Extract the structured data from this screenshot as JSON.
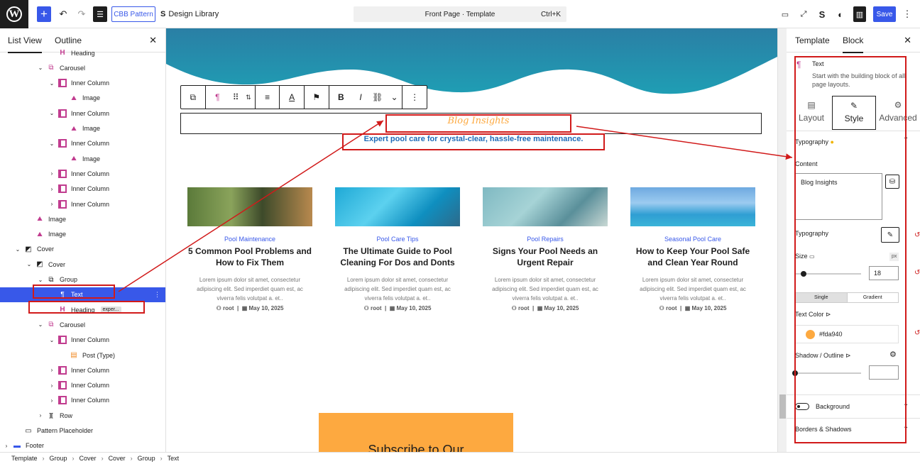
{
  "topbar": {
    "pattern_label": "CBB Pattern",
    "design_library": "Design Library",
    "command_title": "Front Page · Template",
    "command_shortcut": "Ctrl+K",
    "save": "Save"
  },
  "left_panel": {
    "tabs": [
      "List View",
      "Outline"
    ],
    "rows": [
      {
        "label": "Heading",
        "indent": 5,
        "icon": "heading-icon",
        "badge": ""
      },
      {
        "label": "Carousel",
        "indent": 4,
        "icon": "carousel-icon",
        "chev": "⌄"
      },
      {
        "label": "Inner Column",
        "indent": 5,
        "icon": "column-icon",
        "chev": "⌄"
      },
      {
        "label": "Image",
        "indent": 6,
        "icon": "image-icon"
      },
      {
        "label": "Inner Column",
        "indent": 5,
        "icon": "column-icon",
        "chev": "⌄"
      },
      {
        "label": "Image",
        "indent": 6,
        "icon": "image-icon"
      },
      {
        "label": "Inner Column",
        "indent": 5,
        "icon": "column-icon",
        "chev": "⌄"
      },
      {
        "label": "Image",
        "indent": 6,
        "icon": "image-icon"
      },
      {
        "label": "Inner Column",
        "indent": 5,
        "icon": "column-icon",
        "chev": "›"
      },
      {
        "label": "Inner Column",
        "indent": 5,
        "icon": "column-icon",
        "chev": "›"
      },
      {
        "label": "Inner Column",
        "indent": 5,
        "icon": "column-icon",
        "chev": "›"
      },
      {
        "label": "Image",
        "indent": 3,
        "icon": "image-icon"
      },
      {
        "label": "Image",
        "indent": 3,
        "icon": "image-icon"
      },
      {
        "label": "Cover",
        "indent": 2,
        "icon": "cover-icon",
        "chev": "⌄"
      },
      {
        "label": "Cover",
        "indent": 3,
        "icon": "cover-icon",
        "chev": "⌄"
      },
      {
        "label": "Group",
        "indent": 4,
        "icon": "group-icon",
        "chev": "⌄"
      },
      {
        "label": "Text",
        "indent": 5,
        "icon": "paragraph-icon",
        "selected": true
      },
      {
        "label": "Heading",
        "indent": 5,
        "icon": "heading-icon",
        "badge": "exper..."
      },
      {
        "label": "Carousel",
        "indent": 4,
        "icon": "carousel-icon",
        "chev": "⌄"
      },
      {
        "label": "Inner Column",
        "indent": 5,
        "icon": "column-icon",
        "chev": "⌄"
      },
      {
        "label": "Post (Type)",
        "indent": 6,
        "icon": "post-type-icon"
      },
      {
        "label": "Inner Column",
        "indent": 5,
        "icon": "column-icon",
        "chev": "›"
      },
      {
        "label": "Inner Column",
        "indent": 5,
        "icon": "column-icon",
        "chev": "›"
      },
      {
        "label": "Inner Column",
        "indent": 5,
        "icon": "column-icon",
        "chev": "›"
      },
      {
        "label": "Row",
        "indent": 4,
        "icon": "row-icon",
        "chev": "›"
      },
      {
        "label": "Pattern Placeholder",
        "indent": 2,
        "icon": "pattern-icon"
      },
      {
        "label": "Footer",
        "indent": 1,
        "icon": "footer-icon",
        "chev": "›"
      }
    ]
  },
  "canvas": {
    "blog_title": "Blog Insights",
    "subtitle": "Expert pool care for crystal-clear, hassle-free maintenance.",
    "cards": [
      {
        "category": "Pool Maintenance",
        "title": "5 Common Pool Problems and How to Fix Them",
        "excerpt": "Lorem ipsum dolor sit amet, consectetur adipiscing elit. Sed imperdiet quam est, ac viverra felis volutpat a. et..",
        "author": "root",
        "date": "May 10, 2025"
      },
      {
        "category": "Pool Care Tips",
        "title": "The Ultimate Guide to Pool Cleaning For Dos and Donts",
        "excerpt": "Lorem ipsum dolor sit amet, consectetur adipiscing elit. Sed imperdiet quam est, ac viverra felis volutpat a. et..",
        "author": "root",
        "date": "May 10, 2025"
      },
      {
        "category": "Pool Repairs",
        "title": "Signs Your Pool Needs an Urgent Repair",
        "excerpt": "Lorem ipsum dolor sit amet, consectetur adipiscing elit. Sed imperdiet quam est, ac viverra felis volutpat a. et..",
        "author": "root",
        "date": "May 10, 2025"
      },
      {
        "category": "Seasonal Pool Care",
        "title": "How to Keep Your Pool Safe and Clean Year Round",
        "excerpt": "Lorem ipsum dolor sit amet, consectetur adipiscing elit. Sed imperdiet quam est, ac viverra felis volutpat a. et..",
        "author": "root",
        "date": "May 10, 2025"
      }
    ],
    "subscribe_text": "Subscribe to Our"
  },
  "right_panel": {
    "tabs": [
      "Template",
      "Block"
    ],
    "block_name": "Text",
    "block_desc": "Start with the building block of all page layouts.",
    "sub_tabs": [
      "Layout",
      "Style",
      "Advanced"
    ],
    "typography_section": "Typography",
    "content_label": "Content",
    "content_value": "Blog Insights",
    "typography_label": "Typography",
    "size_label": "Size",
    "size_unit": "px",
    "size_value": "18",
    "seg_single": "Single",
    "seg_gradient": "Gradient",
    "text_color_label": "Text Color",
    "text_color_value": "#fda940",
    "shadow_label": "Shadow / Outline",
    "background_label": "Background",
    "borders_label": "Borders & Shadows"
  },
  "breadcrumb": [
    "Template",
    "Group",
    "Cover",
    "Cover",
    "Group",
    "Text"
  ],
  "colors": {
    "accent": "#3858e9",
    "text_color": "#fda940",
    "wave": "#1f8aa5",
    "subscribe": "#fda940"
  }
}
